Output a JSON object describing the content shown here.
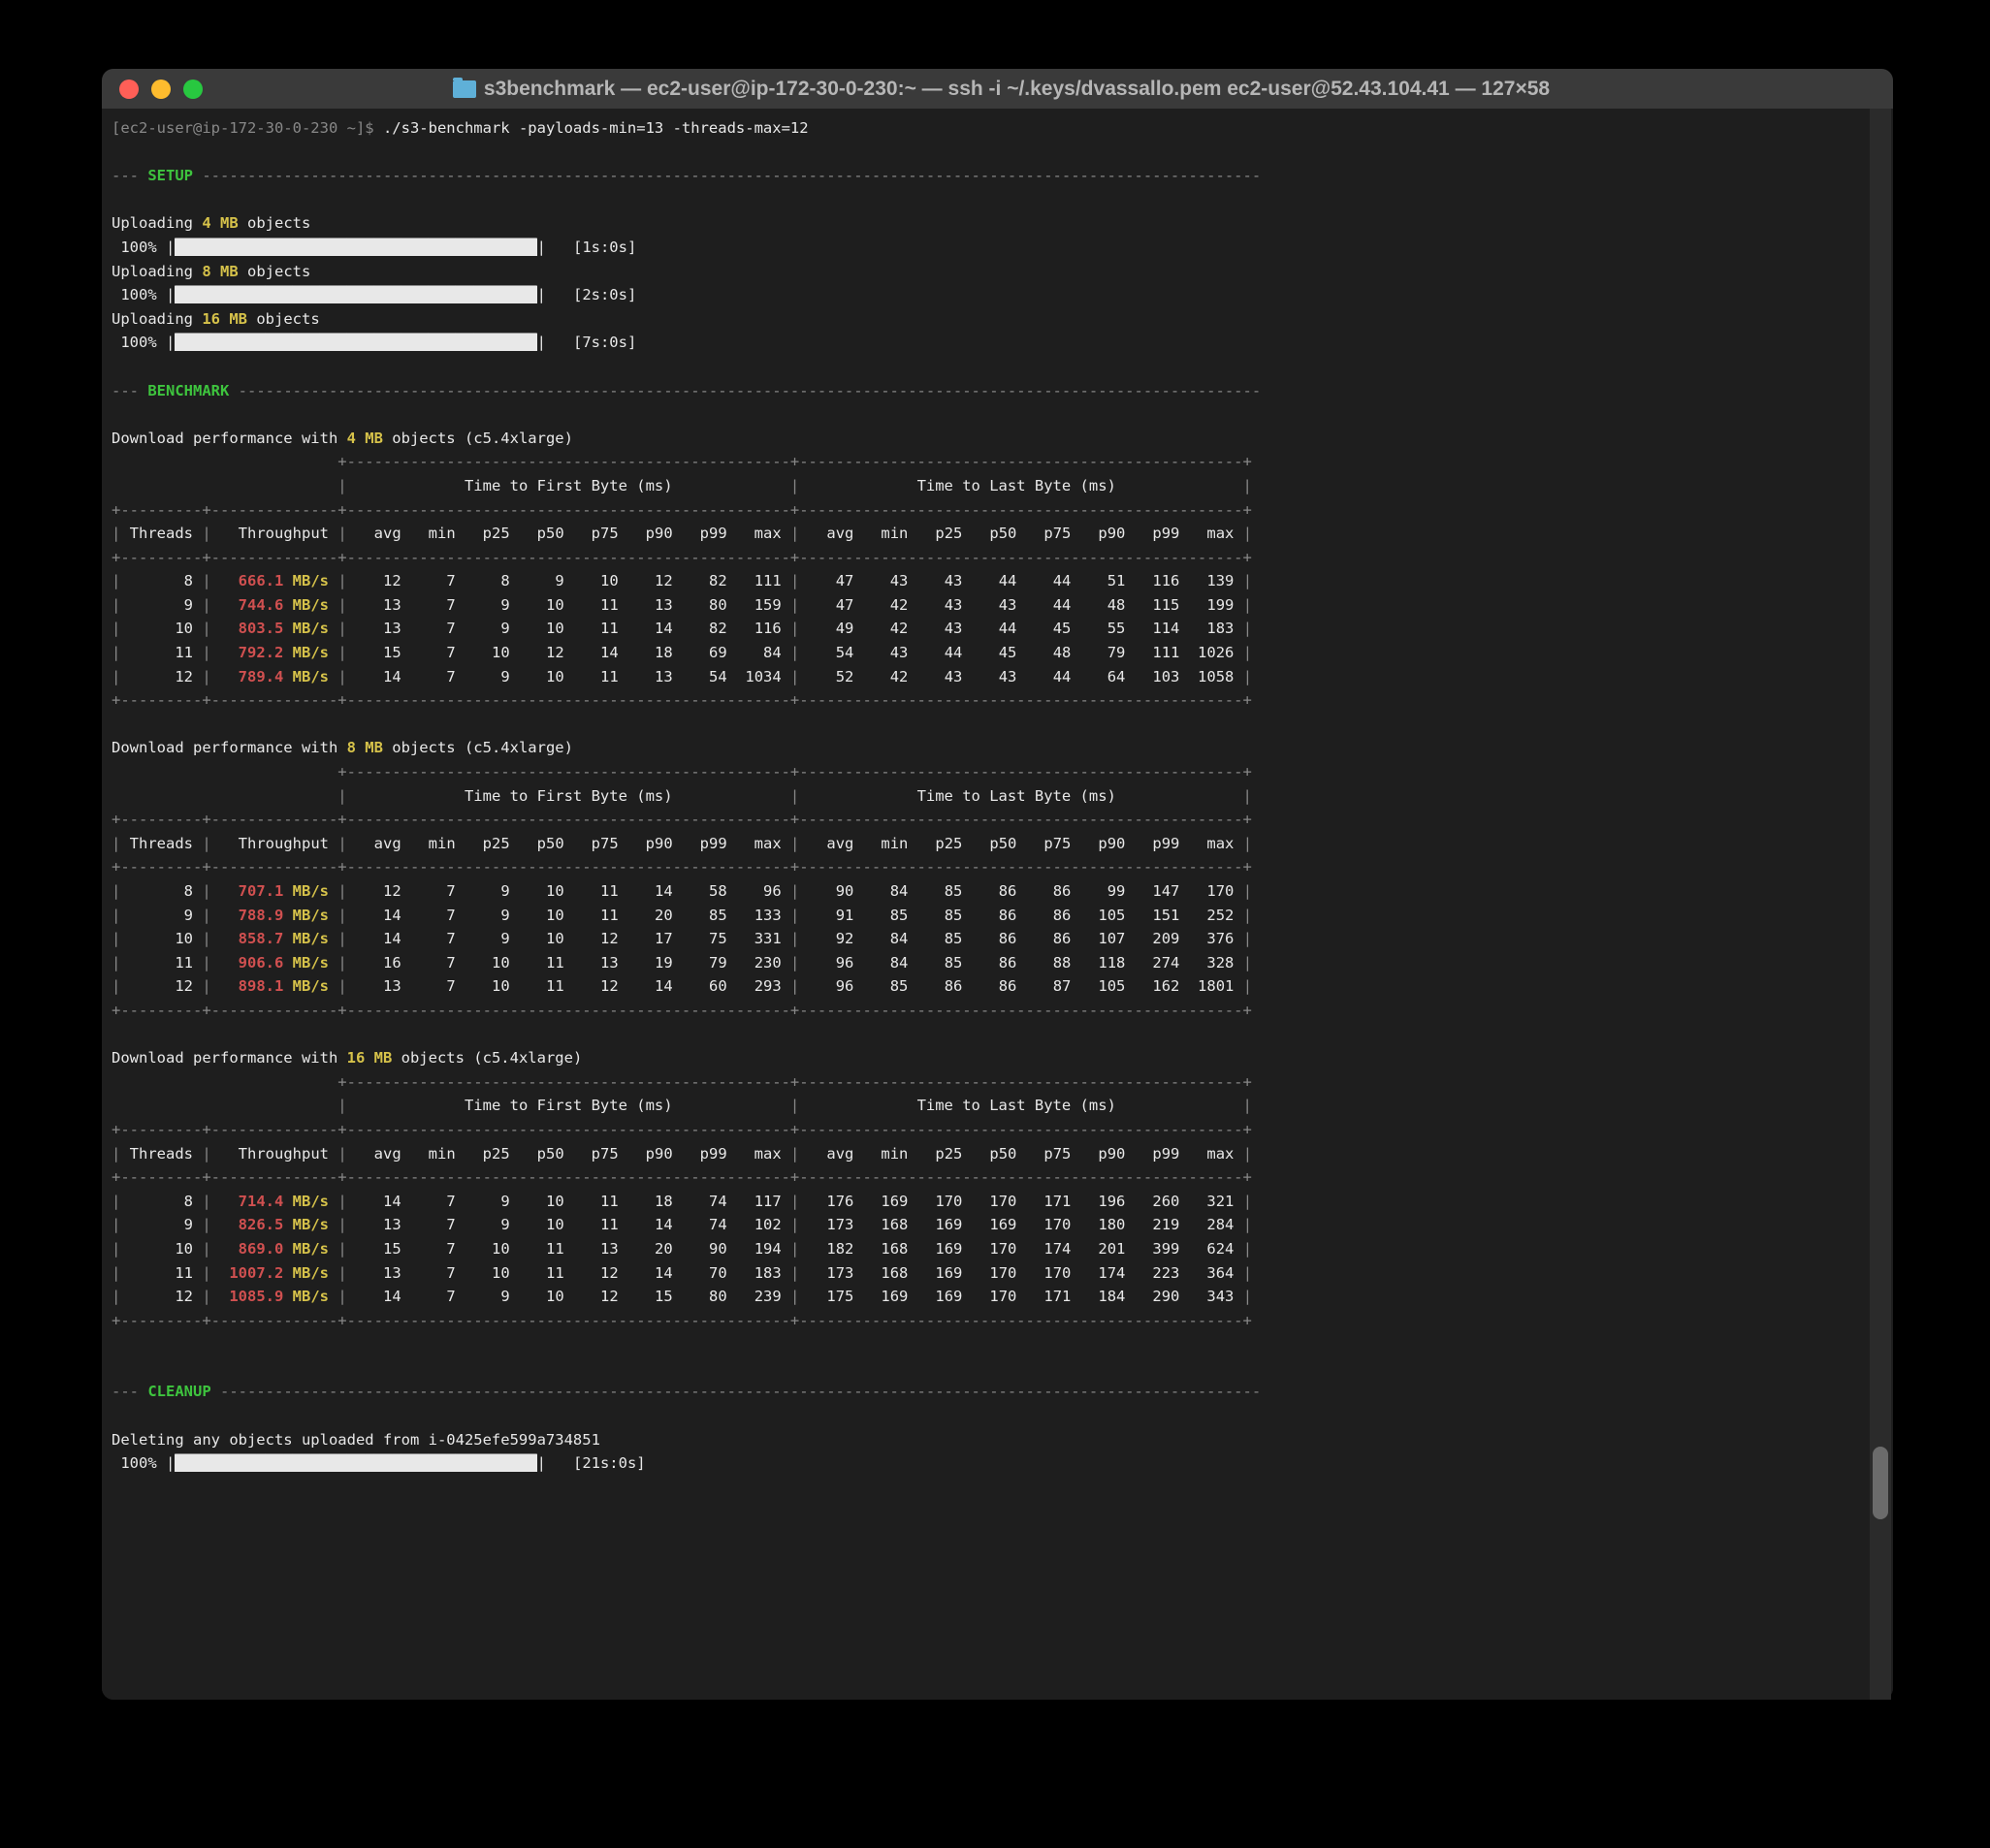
{
  "title": "s3benchmark — ec2-user@ip-172-30-0-230:~ — ssh -i ~/.keys/dvassallo.pem ec2-user@52.43.104.41 — 127×58",
  "prompt": "[ec2-user@ip-172-30-0-230 ~]$ ",
  "command": "./s3-benchmark -payloads-min=13 -threads-max=12",
  "setup_label": "SETUP",
  "benchmark_label": "BENCHMARK",
  "cleanup_label": "CLEANUP",
  "uploads": [
    {
      "pre": "Uploading ",
      "size": "4 MB",
      "post": " objects",
      "pct": "100%",
      "eta": "[1s:0s]"
    },
    {
      "pre": "Uploading ",
      "size": "8 MB",
      "post": " objects",
      "pct": "100%",
      "eta": "[2s:0s]"
    },
    {
      "pre": "Uploading ",
      "size": "16 MB",
      "post": " objects",
      "pct": "100%",
      "eta": "[7s:0s]"
    }
  ],
  "perf_prefix": "Download performance with ",
  "perf_suffix": " objects (c5.4xlarge)",
  "table_headers": {
    "threads": "Threads",
    "throughput": "Throughput",
    "group1": "Time to First Byte (ms)",
    "group2": "Time to Last Byte (ms)",
    "cols": [
      "avg",
      "min",
      "p25",
      "p50",
      "p75",
      "p90",
      "p99",
      "max"
    ]
  },
  "tables": [
    {
      "size": "4 MB",
      "rows": [
        {
          "t": "8",
          "tp": "666.1",
          "u": " MB/s",
          "v": [
            12,
            7,
            8,
            9,
            10,
            12,
            82,
            111,
            47,
            43,
            43,
            44,
            44,
            51,
            116,
            139
          ]
        },
        {
          "t": "9",
          "tp": "744.6",
          "u": " MB/s",
          "v": [
            13,
            7,
            9,
            10,
            11,
            13,
            80,
            159,
            47,
            42,
            43,
            43,
            44,
            48,
            115,
            199
          ]
        },
        {
          "t": "10",
          "tp": "803.5",
          "u": " MB/s",
          "v": [
            13,
            7,
            9,
            10,
            11,
            14,
            82,
            116,
            49,
            42,
            43,
            44,
            45,
            55,
            114,
            183
          ]
        },
        {
          "t": "11",
          "tp": "792.2",
          "u": " MB/s",
          "v": [
            15,
            7,
            10,
            12,
            14,
            18,
            69,
            84,
            54,
            43,
            44,
            45,
            48,
            79,
            111,
            1026
          ]
        },
        {
          "t": "12",
          "tp": "789.4",
          "u": " MB/s",
          "v": [
            14,
            7,
            9,
            10,
            11,
            13,
            54,
            1034,
            52,
            42,
            43,
            43,
            44,
            64,
            103,
            1058
          ]
        }
      ]
    },
    {
      "size": "8 MB",
      "rows": [
        {
          "t": "8",
          "tp": "707.1",
          "u": " MB/s",
          "v": [
            12,
            7,
            9,
            10,
            11,
            14,
            58,
            96,
            90,
            84,
            85,
            86,
            86,
            99,
            147,
            170
          ]
        },
        {
          "t": "9",
          "tp": "788.9",
          "u": " MB/s",
          "v": [
            14,
            7,
            9,
            10,
            11,
            20,
            85,
            133,
            91,
            85,
            85,
            86,
            86,
            105,
            151,
            252
          ]
        },
        {
          "t": "10",
          "tp": "858.7",
          "u": " MB/s",
          "v": [
            14,
            7,
            9,
            10,
            12,
            17,
            75,
            331,
            92,
            84,
            85,
            86,
            86,
            107,
            209,
            376
          ]
        },
        {
          "t": "11",
          "tp": "906.6",
          "u": " MB/s",
          "v": [
            16,
            7,
            10,
            11,
            13,
            19,
            79,
            230,
            96,
            84,
            85,
            86,
            88,
            118,
            274,
            328
          ]
        },
        {
          "t": "12",
          "tp": "898.1",
          "u": " MB/s",
          "v": [
            13,
            7,
            10,
            11,
            12,
            14,
            60,
            293,
            96,
            85,
            86,
            86,
            87,
            105,
            162,
            1801
          ]
        }
      ]
    },
    {
      "size": "16 MB",
      "rows": [
        {
          "t": "8",
          "tp": "714.4",
          "u": " MB/s",
          "v": [
            14,
            7,
            9,
            10,
            11,
            18,
            74,
            117,
            176,
            169,
            170,
            170,
            171,
            196,
            260,
            321
          ]
        },
        {
          "t": "9",
          "tp": "826.5",
          "u": " MB/s",
          "v": [
            13,
            7,
            9,
            10,
            11,
            14,
            74,
            102,
            173,
            168,
            169,
            169,
            170,
            180,
            219,
            284
          ]
        },
        {
          "t": "10",
          "tp": "869.0",
          "u": " MB/s",
          "v": [
            15,
            7,
            10,
            11,
            13,
            20,
            90,
            194,
            182,
            168,
            169,
            170,
            174,
            201,
            399,
            624
          ]
        },
        {
          "t": "11",
          "tp": "1007.2",
          "u": " MB/s",
          "v": [
            13,
            7,
            10,
            11,
            12,
            14,
            70,
            183,
            173,
            168,
            169,
            170,
            170,
            174,
            223,
            364
          ]
        },
        {
          "t": "12",
          "tp": "1085.9",
          "u": " MB/s",
          "v": [
            14,
            7,
            9,
            10,
            12,
            15,
            80,
            239,
            175,
            169,
            169,
            170,
            171,
            184,
            290,
            343
          ]
        }
      ]
    }
  ],
  "cleanup_msg": "Deleting any objects uploaded from i-0425efe599a734851",
  "cleanup_pct": "100%",
  "cleanup_eta": "[21s:0s]"
}
